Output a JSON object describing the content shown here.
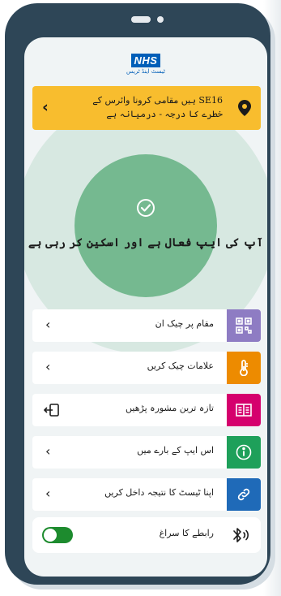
{
  "app": {
    "logo_text": "NHS",
    "logo_subtitle": "ٹیسٹ اینڈ ٹریس"
  },
  "risk_banner": {
    "line1": "ہیں مقامی کرونا وائرس کے SE16",
    "line2": "خطرے کا درجہ - درمیانہ ہے",
    "accent": "#f8bd2e"
  },
  "status": {
    "text": "آپ کی ایپ فعال ہے اور اسکین کر رہی ہے",
    "color_outer": "#d7e8e1",
    "color_inner": "#75b990"
  },
  "menu": [
    {
      "label": "مقام پر چیک ان",
      "icon": "qr-code-icon",
      "color": "#8e7cc3"
    },
    {
      "label": "علامات چیک کریں",
      "icon": "thermometer-icon",
      "color": "#ed8b00"
    },
    {
      "label": "تازہ ترین مشورہ پڑھیں",
      "icon": "book-icon",
      "color": "#d5006d"
    },
    {
      "label": "اس ایپ کے بارے میں",
      "icon": "info-icon",
      "color": "#1ea05a"
    },
    {
      "label": "اپنا ٹیسٹ کا نتیجہ داخل کریں",
      "icon": "link-icon",
      "color": "#1f6ab8"
    }
  ],
  "contact_tracing": {
    "label": "رابطے کا سراغ",
    "toggle_on": true,
    "icon": "bluetooth-icon",
    "toggle_color": "#1d8b2e"
  }
}
